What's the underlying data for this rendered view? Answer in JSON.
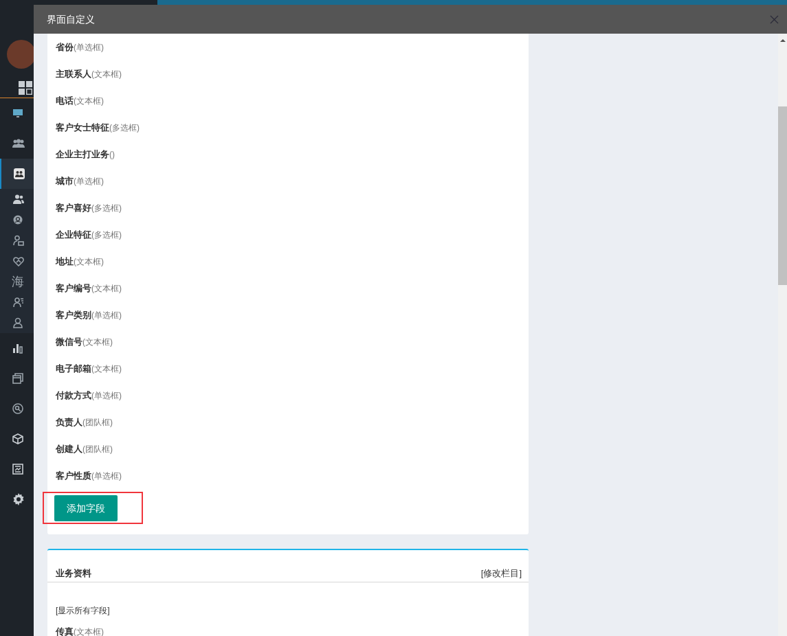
{
  "sidebar": {
    "items": [
      {
        "kind": "icon",
        "selected": false
      },
      {
        "kind": "icon",
        "selected": false
      },
      {
        "kind": "icon",
        "selected": true,
        "expanded": true,
        "children": [
          {
            "kind": "icon",
            "selected": false
          },
          {
            "kind": "icon",
            "selected": false
          },
          {
            "kind": "icon",
            "selected": false
          },
          {
            "kind": "icon",
            "selected": false
          },
          {
            "kind": "text",
            "text": "海",
            "selected": false
          },
          {
            "kind": "icon",
            "selected": false
          },
          {
            "kind": "icon",
            "selected": false
          }
        ]
      },
      {
        "kind": "icon",
        "selected": false
      },
      {
        "kind": "icon",
        "selected": false
      },
      {
        "kind": "icon",
        "selected": false
      },
      {
        "kind": "icon",
        "selected": false
      },
      {
        "kind": "icon",
        "selected": false
      },
      {
        "kind": "icon",
        "selected": false
      }
    ]
  },
  "modal": {
    "title": "界面自定义",
    "sections": [
      {
        "fields": [
          {
            "label": "省份",
            "type": "(单选框)"
          },
          {
            "label": "主联系人",
            "type": "(文本框)"
          },
          {
            "label": "电话",
            "type": "(文本框)"
          },
          {
            "label": "客户女士特征",
            "type": "(多选框)"
          },
          {
            "label": "企业主打业务",
            "type": "()"
          },
          {
            "label": "城市",
            "type": "(单选框)"
          },
          {
            "label": "客户喜好",
            "type": "(多选框)"
          },
          {
            "label": "企业特征",
            "type": "(多选框)"
          },
          {
            "label": "地址",
            "type": "(文本框)"
          },
          {
            "label": "客户编号",
            "type": "(文本框)"
          },
          {
            "label": "客户类别",
            "type": "(单选框)"
          },
          {
            "label": "微信号",
            "type": "(文本框)"
          },
          {
            "label": "电子邮箱",
            "type": "(文本框)"
          },
          {
            "label": "付款方式",
            "type": "(单选框)"
          },
          {
            "label": "负责人",
            "type": "(团队框)"
          },
          {
            "label": "创建人",
            "type": "(团队框)"
          },
          {
            "label": "客户性质",
            "type": "(单选框)"
          }
        ],
        "add_button": "添加字段",
        "add_button_highlighted": true
      },
      {
        "title": "业务资料",
        "action": "[修改栏目]",
        "show_all": "[显示所有字段]",
        "fields": [
          {
            "label": "传真",
            "type": "(文本框)"
          }
        ]
      }
    ]
  }
}
